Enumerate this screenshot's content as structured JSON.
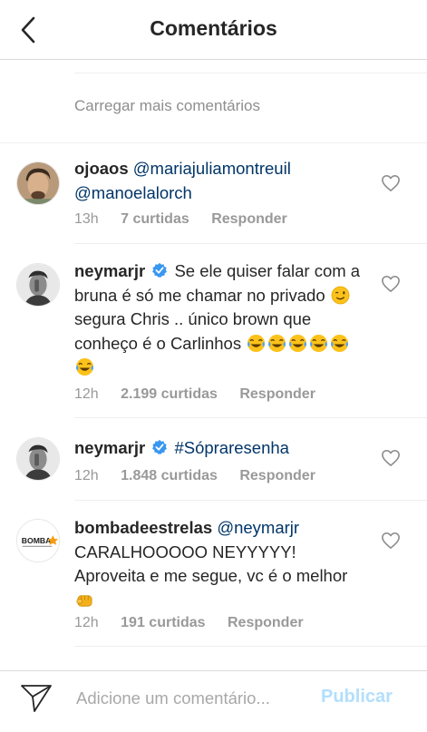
{
  "header": {
    "title": "Comentários",
    "back_icon": "chevron-left-icon"
  },
  "load_more": "Carregar mais comentários",
  "comments": [
    {
      "username": "ojoaos",
      "mention_1": "@mariajuliamontreuil",
      "mention_2": "@manoelalorch",
      "time": "13h",
      "likes": "7 curtidas",
      "reply": "Responder"
    },
    {
      "username": "neymarjr",
      "verified": true,
      "text_1": "Se ele quiser falar com a bruna é só me chamar no privado",
      "text_2": "segura Chris .. único brown que conheço é o Carlinhos",
      "time": "12h",
      "likes": "2.199 curtidas",
      "reply": "Responder"
    },
    {
      "username": "neymarjr",
      "verified": true,
      "hashtag": "#Sópraresenha",
      "time": "12h",
      "likes": "1.848 curtidas",
      "reply": "Responder"
    },
    {
      "username": "bombadeestrelas",
      "mention": "@neymarjr",
      "text": "CARALHOOOOO NEYYYYY! Aproveita e me segue, vc é o melhor",
      "avatar_logo_text": "BOMBA",
      "time": "12h",
      "likes": "191 curtidas",
      "reply": "Responder"
    }
  ],
  "composer": {
    "placeholder": "Adicione um comentário...",
    "publish_label": "Publicar",
    "send_icon": "paper-plane-icon"
  },
  "colors": {
    "link": "#003569",
    "meta": "#999999",
    "publish_disabled": "#b2dffc",
    "verified": "#3897f0"
  }
}
